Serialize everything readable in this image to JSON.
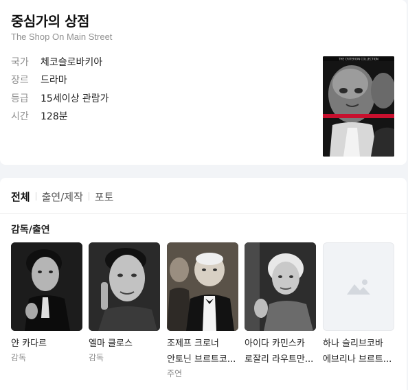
{
  "movie": {
    "title": "중심가의 상점",
    "original_title": "The Shop On Main Street",
    "info": [
      {
        "label": "국가",
        "value": "체코슬로바키아"
      },
      {
        "label": "장르",
        "value": "드라마"
      },
      {
        "label": "등급",
        "value": "15세이상 관람가"
      },
      {
        "label": "시간",
        "value": "128분"
      }
    ],
    "poster_banner": "THE CRITERION COLLECTION"
  },
  "tabs": [
    {
      "label": "전체",
      "active": true
    },
    {
      "label": "출연/제작",
      "active": false
    },
    {
      "label": "포토",
      "active": false
    }
  ],
  "cast_section": {
    "title": "감독/출연",
    "people": [
      {
        "name": "얀 카다르",
        "name2": "",
        "role": "감독"
      },
      {
        "name": "엘마 클로스",
        "name2": "",
        "role": "감독"
      },
      {
        "name": "조제프 크로너",
        "name2": "안토닌 브르트코...",
        "role": "주연"
      },
      {
        "name": "아이다 카민스카",
        "name2": "로잘리 라우트만...",
        "role": ""
      },
      {
        "name": "하나 슬리브코바",
        "name2": "에브리나 브르트...",
        "role": ""
      }
    ]
  },
  "colors": {
    "poster_red": "#c8102e",
    "muted_text": "#8f8f8f"
  }
}
